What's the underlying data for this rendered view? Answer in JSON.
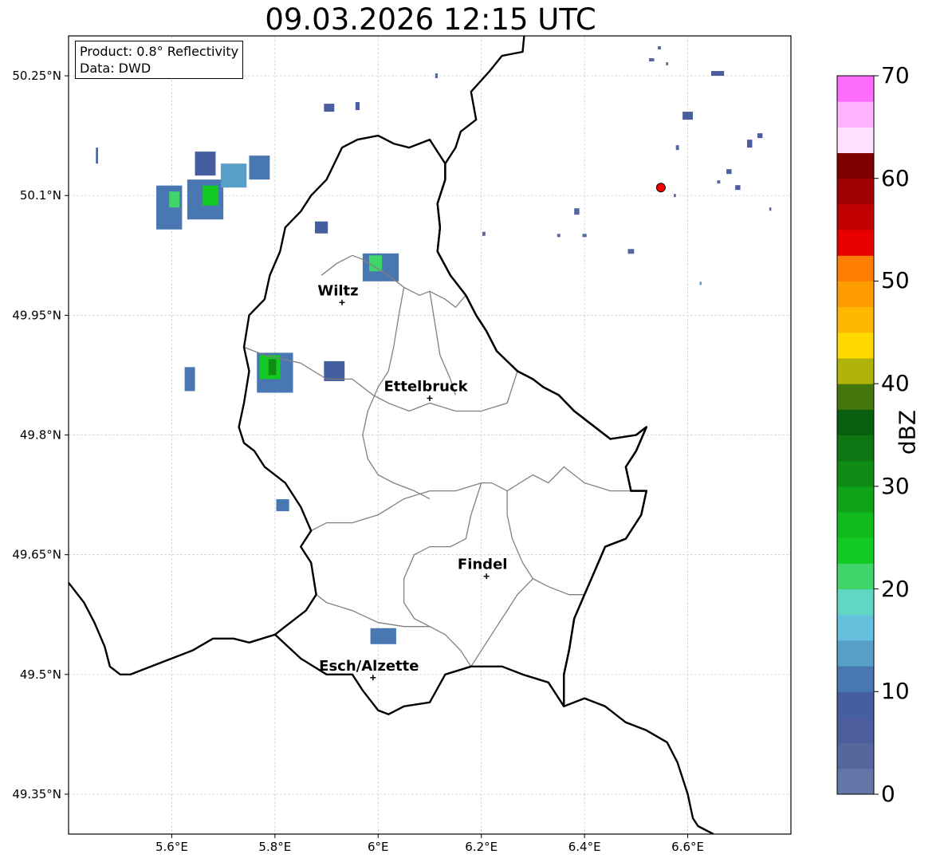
{
  "title": "09.03.2026 12:15 UTC",
  "info_box": {
    "product": "Product: 0.8° Reflectivity",
    "data": "Data: DWD"
  },
  "axes": {
    "lat_ticks": [
      "50.25°N",
      "50.1°N",
      "49.95°N",
      "49.8°N",
      "49.65°N",
      "49.5°N",
      "49.35°N"
    ],
    "lon_ticks": [
      "5.6°E",
      "5.8°E",
      "6°E",
      "6.2°E",
      "6.4°E",
      "6.6°E"
    ],
    "lon_range": [
      5.4,
      6.8
    ],
    "lat_range": [
      49.3,
      50.3
    ],
    "grid": true
  },
  "cities": [
    {
      "name": "Wiltz",
      "lon": 5.93,
      "lat": 49.966
    },
    {
      "name": "Ettelbruck",
      "lon": 6.1,
      "lat": 49.846
    },
    {
      "name": "Findel",
      "lon": 6.21,
      "lat": 49.623
    },
    {
      "name": "Esch/Alzette",
      "lon": 5.99,
      "lat": 49.496
    }
  ],
  "radar_site": {
    "lon": 6.548,
    "lat": 50.11,
    "color": "#ee0000"
  },
  "colorbar": {
    "label": "dBZ",
    "ticks": [
      "0",
      "10",
      "20",
      "30",
      "40",
      "50",
      "60",
      "70"
    ],
    "min": 0,
    "max": 70,
    "step": 2.5,
    "colors": [
      "#6577a8",
      "#56679e",
      "#4c5e9d",
      "#445ea0",
      "#4877b1",
      "#589fc7",
      "#66c1dc",
      "#61d6c2",
      "#3fd56b",
      "#13ca23",
      "#10bb1d",
      "#10a318",
      "#0f8c15",
      "#0d7512",
      "#0a5e0f",
      "#43760c",
      "#b0b30a",
      "#ffd900",
      "#ffb700",
      "#ff9c00",
      "#ff7d00",
      "#e80000",
      "#c10000",
      "#a00000",
      "#7f0000",
      "#ffe0ff",
      "#ffb2ff",
      "#ff6dff",
      "#ec38ec"
    ]
  },
  "echoes": [
    {
      "lon": 5.595,
      "lat": 50.085,
      "w": 0.05,
      "h": 0.055,
      "dbz": 12
    },
    {
      "lon": 5.605,
      "lat": 50.095,
      "w": 0.02,
      "h": 0.02,
      "dbz": 22
    },
    {
      "lon": 5.665,
      "lat": 50.095,
      "w": 0.07,
      "h": 0.05,
      "dbz": 12
    },
    {
      "lon": 5.675,
      "lat": 50.1,
      "w": 0.03,
      "h": 0.025,
      "dbz": 24
    },
    {
      "lon": 5.665,
      "lat": 50.14,
      "w": 0.04,
      "h": 0.03,
      "dbz": 8
    },
    {
      "lon": 5.72,
      "lat": 50.125,
      "w": 0.05,
      "h": 0.03,
      "dbz": 14
    },
    {
      "lon": 5.77,
      "lat": 50.135,
      "w": 0.04,
      "h": 0.03,
      "dbz": 12
    },
    {
      "lon": 5.455,
      "lat": 50.15,
      "w": 0.004,
      "h": 0.02,
      "dbz": 8
    },
    {
      "lon": 5.89,
      "lat": 50.06,
      "w": 0.025,
      "h": 0.015,
      "dbz": 8
    },
    {
      "lon": 6.005,
      "lat": 50.01,
      "w": 0.07,
      "h": 0.035,
      "dbz": 12
    },
    {
      "lon": 5.995,
      "lat": 50.015,
      "w": 0.025,
      "h": 0.02,
      "dbz": 20
    },
    {
      "lon": 5.8,
      "lat": 49.878,
      "w": 0.07,
      "h": 0.05,
      "dbz": 12
    },
    {
      "lon": 5.79,
      "lat": 49.885,
      "w": 0.04,
      "h": 0.03,
      "dbz": 24
    },
    {
      "lon": 5.795,
      "lat": 49.885,
      "w": 0.015,
      "h": 0.02,
      "dbz": 32
    },
    {
      "lon": 5.915,
      "lat": 49.88,
      "w": 0.04,
      "h": 0.025,
      "dbz": 8
    },
    {
      "lon": 5.635,
      "lat": 49.87,
      "w": 0.02,
      "h": 0.03,
      "dbz": 12
    },
    {
      "lon": 5.815,
      "lat": 49.712,
      "w": 0.025,
      "h": 0.015,
      "dbz": 10
    },
    {
      "lon": 6.01,
      "lat": 49.548,
      "w": 0.05,
      "h": 0.02,
      "dbz": 12
    },
    {
      "lon": 5.905,
      "lat": 50.21,
      "w": 0.02,
      "h": 0.01,
      "dbz": 6
    },
    {
      "lon": 5.96,
      "lat": 50.212,
      "w": 0.008,
      "h": 0.01,
      "dbz": 6
    },
    {
      "lon": 6.658,
      "lat": 50.253,
      "w": 0.025,
      "h": 0.006,
      "dbz": 6
    },
    {
      "lon": 6.6,
      "lat": 50.2,
      "w": 0.02,
      "h": 0.01,
      "dbz": 6
    },
    {
      "lon": 6.72,
      "lat": 50.165,
      "w": 0.01,
      "h": 0.01,
      "dbz": 6
    },
    {
      "lon": 6.74,
      "lat": 50.175,
      "w": 0.01,
      "h": 0.006,
      "dbz": 6
    },
    {
      "lon": 6.68,
      "lat": 50.13,
      "w": 0.01,
      "h": 0.006,
      "dbz": 6
    },
    {
      "lon": 6.697,
      "lat": 50.11,
      "w": 0.01,
      "h": 0.006,
      "dbz": 6
    },
    {
      "lon": 6.58,
      "lat": 50.16,
      "w": 0.006,
      "h": 0.006,
      "dbz": 4
    },
    {
      "lon": 6.545,
      "lat": 50.285,
      "w": 0.006,
      "h": 0.004,
      "dbz": 4
    },
    {
      "lon": 6.53,
      "lat": 50.27,
      "w": 0.01,
      "h": 0.004,
      "dbz": 4
    },
    {
      "lon": 6.56,
      "lat": 50.265,
      "w": 0.004,
      "h": 0.004,
      "dbz": 4
    },
    {
      "lon": 6.49,
      "lat": 50.03,
      "w": 0.012,
      "h": 0.006,
      "dbz": 4
    },
    {
      "lon": 6.385,
      "lat": 50.08,
      "w": 0.01,
      "h": 0.008,
      "dbz": 4
    },
    {
      "lon": 6.4,
      "lat": 50.05,
      "w": 0.008,
      "h": 0.004,
      "dbz": 4
    },
    {
      "lon": 6.35,
      "lat": 50.05,
      "w": 0.006,
      "h": 0.004,
      "dbz": 4
    },
    {
      "lon": 6.205,
      "lat": 50.052,
      "w": 0.006,
      "h": 0.005,
      "dbz": 4
    },
    {
      "lon": 6.113,
      "lat": 50.25,
      "w": 0.005,
      "h": 0.006,
      "dbz": 4
    },
    {
      "lon": 6.575,
      "lat": 50.1,
      "w": 0.004,
      "h": 0.004,
      "dbz": 4
    },
    {
      "lon": 6.66,
      "lat": 50.117,
      "w": 0.006,
      "h": 0.004,
      "dbz": 4
    },
    {
      "lon": 6.76,
      "lat": 50.083,
      "w": 0.004,
      "h": 0.004,
      "dbz": 4
    },
    {
      "lon": 6.625,
      "lat": 49.99,
      "w": 0.004,
      "h": 0.004,
      "dbz": 14
    }
  ],
  "boundaries": {
    "national": [
      [
        [
          6.283,
          50.3
        ],
        [
          6.28,
          50.28
        ],
        [
          6.24,
          50.275
        ],
        [
          6.215,
          50.255
        ],
        [
          6.18,
          50.23
        ],
        [
          6.19,
          50.195
        ],
        [
          6.16,
          50.18
        ],
        [
          6.15,
          50.16
        ],
        [
          6.13,
          50.14
        ],
        [
          6.13,
          50.12
        ],
        [
          6.115,
          50.09
        ],
        [
          6.12,
          50.06
        ],
        [
          6.115,
          50.03
        ],
        [
          6.14,
          50.0
        ],
        [
          6.17,
          49.975
        ],
        [
          6.19,
          49.95
        ],
        [
          6.21,
          49.93
        ],
        [
          6.23,
          49.905
        ],
        [
          6.27,
          49.88
        ],
        [
          6.3,
          49.87
        ],
        [
          6.32,
          49.86
        ],
        [
          6.35,
          49.85
        ],
        [
          6.38,
          49.83
        ],
        [
          6.42,
          49.81
        ],
        [
          6.45,
          49.795
        ],
        [
          6.5,
          49.8
        ],
        [
          6.52,
          49.81
        ],
        [
          6.5,
          49.78
        ],
        [
          6.48,
          49.76
        ],
        [
          6.49,
          49.73
        ],
        [
          6.52,
          49.73
        ],
        [
          6.51,
          49.7
        ],
        [
          6.48,
          49.67
        ],
        [
          6.44,
          49.66
        ],
        [
          6.42,
          49.63
        ],
        [
          6.4,
          49.6
        ],
        [
          6.38,
          49.57
        ],
        [
          6.37,
          49.53
        ],
        [
          6.36,
          49.5
        ],
        [
          6.36,
          49.46
        ]
      ],
      [
        [
          5.4,
          49.615
        ],
        [
          5.43,
          49.59
        ],
        [
          5.45,
          49.565
        ],
        [
          5.47,
          49.535
        ],
        [
          5.48,
          49.51
        ],
        [
          5.5,
          49.5
        ],
        [
          5.52,
          49.5
        ],
        [
          5.56,
          49.51
        ],
        [
          5.6,
          49.52
        ],
        [
          5.64,
          49.53
        ],
        [
          5.68,
          49.545
        ],
        [
          5.72,
          49.545
        ],
        [
          5.75,
          49.54
        ],
        [
          5.8,
          49.55
        ]
      ],
      [
        [
          6.36,
          49.46
        ],
        [
          6.4,
          49.47
        ],
        [
          6.44,
          49.46
        ],
        [
          6.48,
          49.44
        ],
        [
          6.52,
          49.43
        ],
        [
          6.56,
          49.415
        ],
        [
          6.58,
          49.39
        ],
        [
          6.59,
          49.37
        ],
        [
          6.6,
          49.35
        ],
        [
          6.61,
          49.32
        ],
        [
          6.62,
          49.31
        ],
        [
          6.65,
          49.3
        ]
      ]
    ],
    "luxembourg": [
      [
        5.8,
        49.55
      ],
      [
        5.85,
        49.52
      ],
      [
        5.9,
        49.5
      ],
      [
        5.95,
        49.5
      ],
      [
        5.97,
        49.48
      ],
      [
        6.0,
        49.455
      ],
      [
        6.02,
        49.45
      ],
      [
        6.05,
        49.46
      ],
      [
        6.1,
        49.465
      ],
      [
        6.13,
        49.5
      ],
      [
        6.18,
        49.51
      ],
      [
        6.24,
        49.51
      ],
      [
        6.28,
        49.5
      ],
      [
        6.33,
        49.49
      ],
      [
        6.36,
        49.46
      ],
      [
        6.36,
        49.5
      ],
      [
        6.37,
        49.53
      ],
      [
        6.38,
        49.57
      ],
      [
        6.4,
        49.6
      ],
      [
        6.42,
        49.63
      ],
      [
        6.44,
        49.66
      ],
      [
        6.48,
        49.67
      ],
      [
        6.51,
        49.7
      ],
      [
        6.52,
        49.73
      ],
      [
        6.49,
        49.73
      ],
      [
        6.48,
        49.76
      ],
      [
        6.5,
        49.78
      ],
      [
        6.52,
        49.81
      ],
      [
        6.5,
        49.8
      ],
      [
        6.45,
        49.795
      ],
      [
        6.42,
        49.81
      ],
      [
        6.38,
        49.83
      ],
      [
        6.35,
        49.85
      ],
      [
        6.32,
        49.86
      ],
      [
        6.3,
        49.87
      ],
      [
        6.27,
        49.88
      ],
      [
        6.23,
        49.905
      ],
      [
        6.21,
        49.93
      ],
      [
        6.19,
        49.95
      ],
      [
        6.17,
        49.975
      ],
      [
        6.14,
        50.0
      ],
      [
        6.115,
        50.03
      ],
      [
        6.12,
        50.06
      ],
      [
        6.115,
        50.09
      ],
      [
        6.13,
        50.12
      ],
      [
        6.13,
        50.14
      ],
      [
        6.1,
        50.17
      ],
      [
        6.06,
        50.16
      ],
      [
        6.03,
        50.165
      ],
      [
        6.0,
        50.175
      ],
      [
        5.96,
        50.17
      ],
      [
        5.93,
        50.16
      ],
      [
        5.9,
        50.12
      ],
      [
        5.87,
        50.1
      ],
      [
        5.85,
        50.08
      ],
      [
        5.82,
        50.06
      ],
      [
        5.81,
        50.03
      ],
      [
        5.79,
        50.0
      ],
      [
        5.78,
        49.97
      ],
      [
        5.75,
        49.95
      ],
      [
        5.74,
        49.91
      ],
      [
        5.75,
        49.88
      ],
      [
        5.74,
        49.84
      ],
      [
        5.73,
        49.81
      ],
      [
        5.74,
        49.79
      ],
      [
        5.76,
        49.78
      ],
      [
        5.78,
        49.76
      ],
      [
        5.82,
        49.74
      ],
      [
        5.85,
        49.71
      ],
      [
        5.87,
        49.68
      ],
      [
        5.85,
        49.66
      ],
      [
        5.87,
        49.64
      ],
      [
        5.88,
        49.6
      ],
      [
        5.86,
        49.58
      ],
      [
        5.82,
        49.56
      ],
      [
        5.8,
        49.55
      ]
    ],
    "cantons": [
      [
        [
          5.89,
          50.0
        ],
        [
          5.92,
          50.015
        ],
        [
          5.95,
          50.025
        ],
        [
          5.97,
          50.02
        ],
        [
          6.02,
          50.0
        ],
        [
          6.05,
          49.985
        ],
        [
          6.08,
          49.975
        ],
        [
          6.1,
          49.98
        ],
        [
          6.13,
          49.97
        ],
        [
          6.15,
          49.96
        ],
        [
          6.17,
          49.975
        ]
      ],
      [
        [
          6.05,
          49.985
        ],
        [
          6.04,
          49.95
        ],
        [
          6.03,
          49.91
        ],
        [
          6.02,
          49.88
        ],
        [
          6.0,
          49.86
        ],
        [
          5.98,
          49.83
        ],
        [
          5.97,
          49.8
        ],
        [
          5.98,
          49.77
        ],
        [
          6.0,
          49.75
        ],
        [
          6.03,
          49.74
        ],
        [
          6.07,
          49.73
        ],
        [
          6.1,
          49.72
        ]
      ],
      [
        [
          5.74,
          49.91
        ],
        [
          5.78,
          49.9
        ],
        [
          5.85,
          49.89
        ],
        [
          5.9,
          49.87
        ],
        [
          5.95,
          49.87
        ],
        [
          5.99,
          49.85
        ],
        [
          6.02,
          49.84
        ],
        [
          6.06,
          49.83
        ],
        [
          6.1,
          49.84
        ],
        [
          6.15,
          49.83
        ],
        [
          6.2,
          49.83
        ],
        [
          6.25,
          49.84
        ],
        [
          6.27,
          49.88
        ]
      ],
      [
        [
          6.1,
          49.98
        ],
        [
          6.11,
          49.94
        ],
        [
          6.12,
          49.9
        ],
        [
          6.14,
          49.87
        ],
        [
          6.15,
          49.85
        ]
      ],
      [
        [
          5.87,
          49.68
        ],
        [
          5.9,
          49.69
        ],
        [
          5.95,
          49.69
        ],
        [
          6.0,
          49.7
        ],
        [
          6.05,
          49.72
        ],
        [
          6.1,
          49.73
        ],
        [
          6.15,
          49.73
        ],
        [
          6.2,
          49.74
        ],
        [
          6.22,
          49.74
        ],
        [
          6.25,
          49.73
        ],
        [
          6.3,
          49.75
        ],
        [
          6.33,
          49.74
        ],
        [
          6.36,
          49.76
        ],
        [
          6.4,
          49.74
        ],
        [
          6.45,
          49.73
        ],
        [
          6.49,
          49.73
        ]
      ],
      [
        [
          6.25,
          49.73
        ],
        [
          6.25,
          49.7
        ],
        [
          6.26,
          49.67
        ],
        [
          6.28,
          49.64
        ],
        [
          6.3,
          49.62
        ],
        [
          6.33,
          49.61
        ],
        [
          6.37,
          49.6
        ],
        [
          6.4,
          49.6
        ]
      ],
      [
        [
          6.2,
          49.74
        ],
        [
          6.18,
          49.7
        ],
        [
          6.17,
          49.67
        ],
        [
          6.14,
          49.66
        ],
        [
          6.1,
          49.66
        ],
        [
          6.07,
          49.65
        ],
        [
          6.05,
          49.62
        ],
        [
          6.05,
          49.59
        ],
        [
          6.07,
          49.57
        ],
        [
          6.1,
          49.56
        ],
        [
          6.13,
          49.55
        ],
        [
          6.16,
          49.53
        ],
        [
          6.18,
          49.51
        ]
      ],
      [
        [
          5.88,
          49.6
        ],
        [
          5.9,
          49.59
        ],
        [
          5.95,
          49.58
        ],
        [
          6.0,
          49.565
        ],
        [
          6.05,
          49.56
        ],
        [
          6.1,
          49.56
        ]
      ],
      [
        [
          6.18,
          49.51
        ],
        [
          6.23,
          49.56
        ],
        [
          6.27,
          49.6
        ],
        [
          6.3,
          49.62
        ]
      ]
    ]
  }
}
